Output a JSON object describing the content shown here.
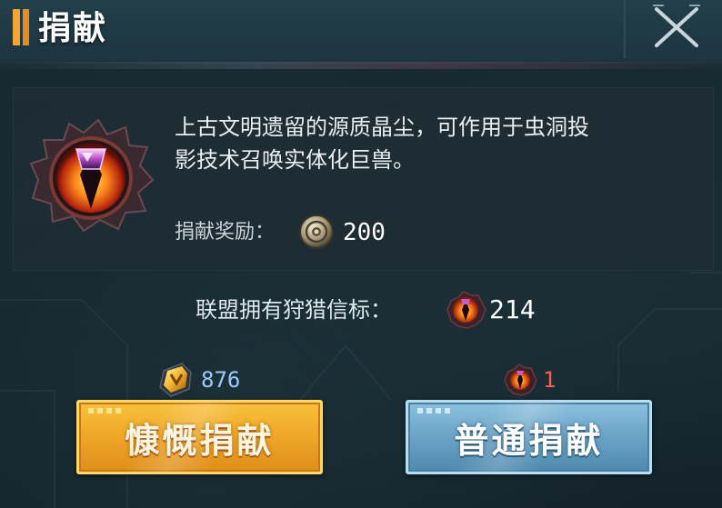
{
  "header": {
    "title": "捐献",
    "close_icon": "close-x-icon"
  },
  "item": {
    "icon": "dragon-eye-icon",
    "description_line1": "上古文明遗留的源质晶尘，可作用于虫洞投",
    "description_line2": "影技术召唤实体化巨兽。",
    "reward_label": "捐献奖励：",
    "reward_icon": "alliance-coin-icon",
    "reward_value": "200"
  },
  "alliance": {
    "label": "联盟拥有狩猎信标：",
    "icon": "hunting-beacon-eye-icon",
    "value": "214"
  },
  "costs": {
    "generous": {
      "icon": "gold-crystal-icon",
      "value": "876",
      "color": "#9fc8ff"
    },
    "normal": {
      "icon": "hunting-beacon-eye-icon",
      "value": "1",
      "color": "#ff5b55"
    }
  },
  "buttons": {
    "generous_label": "慷慨捐献",
    "normal_label": "普通捐献"
  },
  "colors": {
    "gold_button": "#f0a92a",
    "blue_button": "#6aa3c6",
    "accent_orange": "#f2a533"
  }
}
